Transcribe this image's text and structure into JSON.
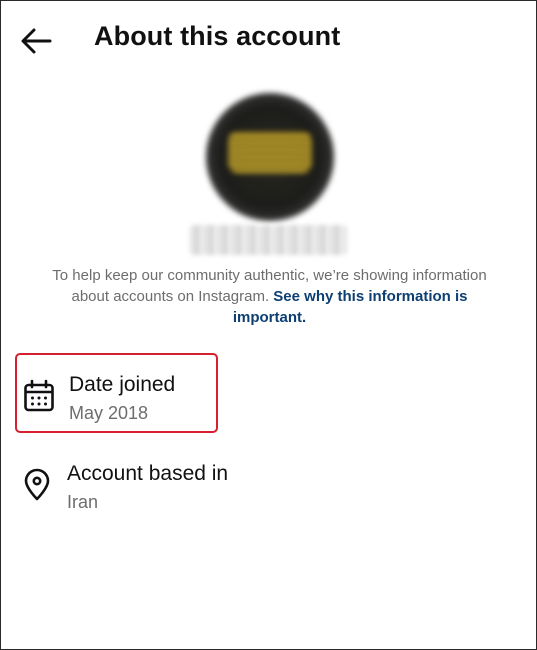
{
  "header": {
    "title": "About this account",
    "back_icon": "arrow-left-icon"
  },
  "profile": {
    "avatar_icon": "blurred-profile-avatar",
    "username_hidden": true
  },
  "info": {
    "text": "To help keep our community authentic, we’re showing information about accounts on Instagram. ",
    "link": "See why this information is important."
  },
  "details": {
    "date_joined": {
      "label": "Date joined",
      "value": "May 2018",
      "icon": "calendar-icon",
      "highlight_color": "#d5202f"
    },
    "account_based_in": {
      "label": "Account based in",
      "value": "Iran",
      "icon": "location-pin-icon"
    }
  }
}
